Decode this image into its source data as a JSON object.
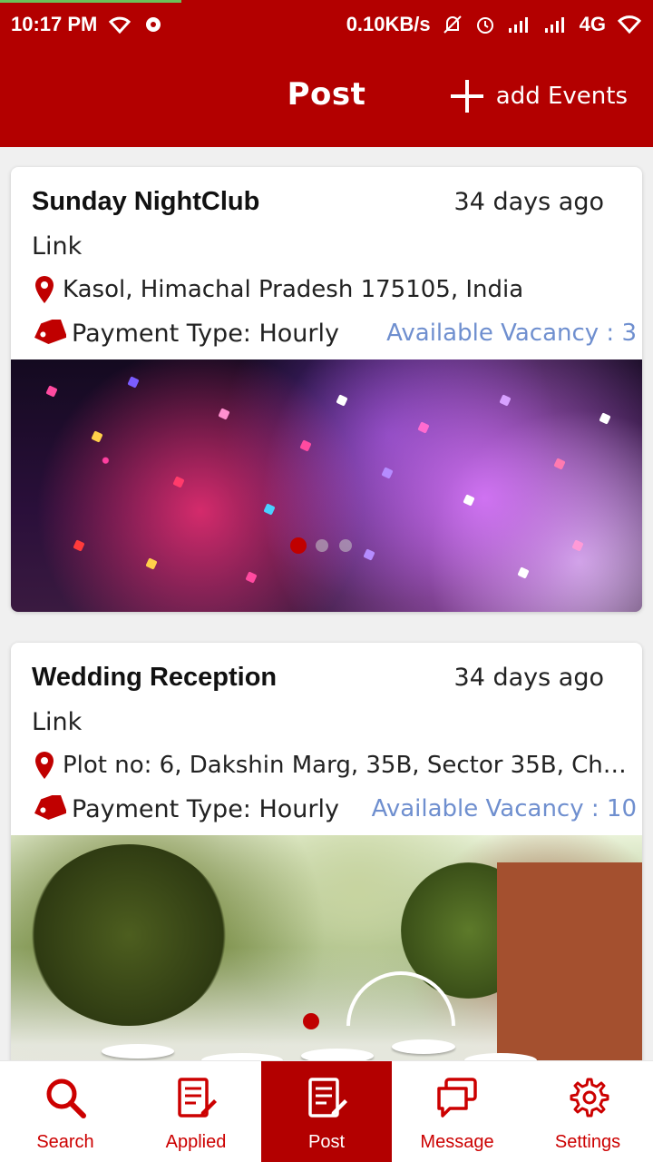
{
  "status_bar": {
    "time": "10:17 PM",
    "network_speed": "0.10KB/s",
    "network_type": "4G",
    "icons": [
      "wifi-icon",
      "hotspot-icon",
      "silent-icon",
      "alarm-icon",
      "signal-icon",
      "signal-icon",
      "wifi-icon"
    ]
  },
  "app_bar": {
    "title": "Post",
    "add_label": "add Events",
    "color": "#b30000"
  },
  "posts": [
    {
      "title": "Sunday NightClub",
      "ago": "34 days ago",
      "link": "Link",
      "location": "Kasol, Himachal Pradesh 175105, India",
      "payment": "Payment Type: Hourly",
      "vacancy": "Available Vacancy : 3",
      "image": "party-confetti-photo"
    },
    {
      "title": "Wedding Reception",
      "ago": "34 days ago",
      "link": "Link",
      "location": "Plot no: 6, Dakshin Marg, 35B, Sector 35B, Ch…",
      "payment": "Payment Type: Hourly",
      "vacancy": "Available Vacancy : 10",
      "image": "wedding-garden-photo"
    }
  ],
  "bottom_nav": {
    "items": [
      {
        "label": "Search",
        "icon": "search-icon"
      },
      {
        "label": "Applied",
        "icon": "document-edit-icon"
      },
      {
        "label": "Post",
        "icon": "document-edit-icon",
        "active": true
      },
      {
        "label": "Message",
        "icon": "chat-icon"
      },
      {
        "label": "Settings",
        "icon": "gear-icon"
      }
    ]
  },
  "colors": {
    "accent": "#b30000",
    "vacancy_text": "#6f8fcf",
    "nav_icon": "#cc0000"
  }
}
